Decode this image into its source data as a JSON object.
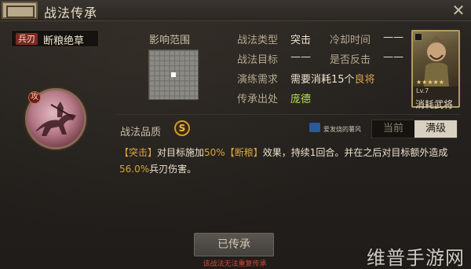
{
  "window": {
    "title": "战法传承",
    "close_glyph": "✕"
  },
  "skill": {
    "type_badge": "兵刃",
    "name": "断粮绝草",
    "medallion_badge": "攻"
  },
  "range": {
    "label": "影响范围"
  },
  "info": {
    "rows": [
      {
        "label": "战法类型",
        "value": "突击",
        "label2": "冷却时间",
        "value2": "——"
      },
      {
        "label": "战法目标",
        "value": "——",
        "label2": "是否反击",
        "value2": "——"
      },
      {
        "label": "演练需求",
        "value_prefix": "需要消耗15个",
        "value_accent": "良将"
      },
      {
        "label": "传承出处",
        "value_green": "庞德"
      }
    ]
  },
  "card": {
    "caption": "消耗武将",
    "stars": "★★★★★",
    "level": "Lv.7"
  },
  "quality": {
    "label": "战法品质",
    "grade": "S"
  },
  "watermark_small": "爱发烧的薯风",
  "toggle": {
    "current": "当前",
    "max": "满级"
  },
  "description": {
    "prefix": "【突击】",
    "part1": "对目标施加",
    "pct1": "50%",
    "tag": "【断粮】",
    "part2": "效果，持续1回合。并在之后对目标额外造成",
    "pct2": "56.0%",
    "part3": "兵刃伤害。"
  },
  "inherit_button": "已传承",
  "inherit_hint": "该战法无法重复传承",
  "site_watermark": "维普手游网"
}
